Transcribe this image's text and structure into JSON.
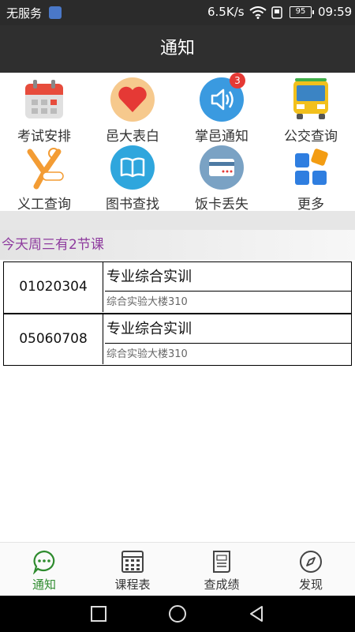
{
  "status_bar": {
    "carrier": "无服务",
    "net_speed": "6.5K/s",
    "battery": "95",
    "time": "09:59"
  },
  "header": {
    "title": "通知"
  },
  "grid": [
    {
      "label": "考试安排",
      "icon": "calendar-icon"
    },
    {
      "label": "邑大表白",
      "icon": "heart-icon"
    },
    {
      "label": "掌邑通知",
      "icon": "speaker-icon",
      "badge": "3"
    },
    {
      "label": "公交查询",
      "icon": "bus-icon"
    },
    {
      "label": "义工查询",
      "icon": "volunteer-icon"
    },
    {
      "label": "图书查找",
      "icon": "book-icon"
    },
    {
      "label": "饭卡丢失",
      "icon": "card-icon"
    },
    {
      "label": "更多",
      "icon": "more-icon"
    }
  ],
  "today": {
    "text": "今天周三有2节课"
  },
  "courses": [
    {
      "code": "01020304",
      "name": "专业综合实训",
      "room": "综合实验大楼310"
    },
    {
      "code": "05060708",
      "name": "专业综合实训",
      "room": "综合实验大楼310"
    }
  ],
  "tabs": [
    {
      "label": "通知",
      "icon": "chat-bubble-icon"
    },
    {
      "label": "课程表",
      "icon": "schedule-icon"
    },
    {
      "label": "查成绩",
      "icon": "score-sheet-icon"
    },
    {
      "label": "发现",
      "icon": "compass-icon"
    }
  ],
  "colors": {
    "active_tab": "#2e8b2e",
    "today_text": "#8e3b9e",
    "header_bg": "#2f2f2f"
  }
}
